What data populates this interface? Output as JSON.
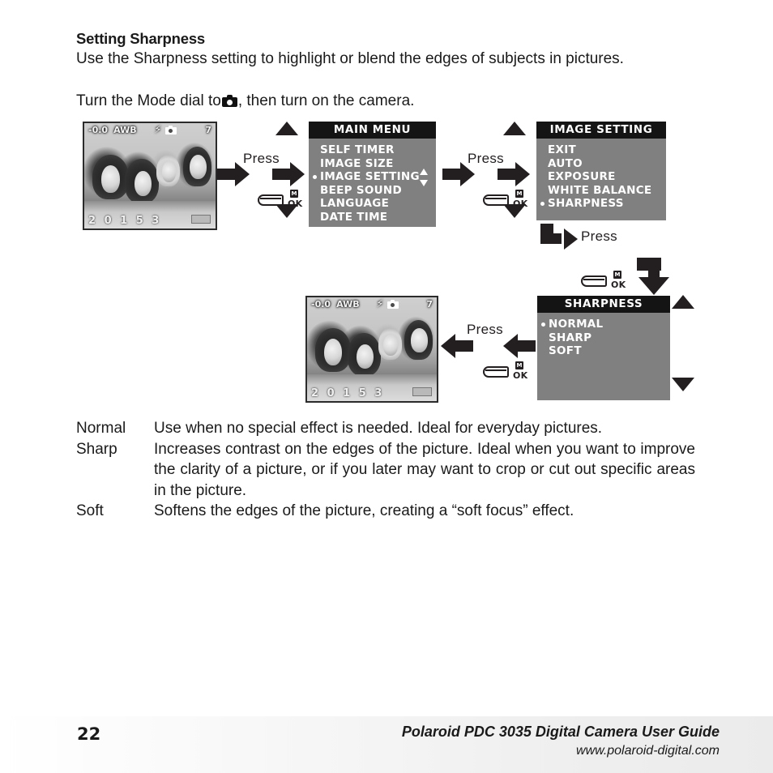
{
  "heading": "Setting Sharpness",
  "intro": {
    "line1": "Use the Sharpness setting to highlight or blend the edges of subjects in pictures.",
    "line2_before": "Turn the Mode dial to",
    "line2_after": ", then turn on the camera."
  },
  "lcd": {
    "ev": "-0.0",
    "awb": "AWB",
    "flash_icon": "flash-bolt-icon",
    "mode_icon": "camera-mode-icon",
    "shots_remaining": "7",
    "bottom_info": "2 0 1 5 3",
    "battery_icon": "battery-icon"
  },
  "menus": {
    "main": {
      "title": "MAIN  MENU",
      "items": [
        {
          "label": "SELF TIMER",
          "selected": false
        },
        {
          "label": "IMAGE  SIZE",
          "selected": false
        },
        {
          "label": "IMAGE  SETTING",
          "selected": true
        },
        {
          "label": "BEEP  SOUND",
          "selected": false
        },
        {
          "label": "LANGUAGE",
          "selected": false
        },
        {
          "label": "DATE  TIME",
          "selected": false
        }
      ]
    },
    "image_setting": {
      "title": "IMAGE SETTING",
      "items": [
        {
          "label": "EXIT",
          "selected": false
        },
        {
          "label": "AUTO",
          "selected": false
        },
        {
          "label": "EXPOSURE",
          "selected": false
        },
        {
          "label": "WHITE BALANCE",
          "selected": false
        },
        {
          "label": "SHARPNESS",
          "selected": true
        }
      ]
    },
    "sharpness": {
      "title": "SHARPNESS",
      "items": [
        {
          "label": "NORMAL",
          "selected": true
        },
        {
          "label": "SHARP",
          "selected": false
        },
        {
          "label": "SOFT",
          "selected": false
        }
      ]
    }
  },
  "flow": {
    "press_1": "Press",
    "press_2": "Press",
    "press_3": "Press",
    "press_4": "Press",
    "button_m": "M",
    "button_ok": "OK"
  },
  "definitions": [
    {
      "term": "Normal",
      "desc": "Use when no special effect is needed. Ideal for everyday pictures."
    },
    {
      "term": "Sharp",
      "desc": "Increases contrast on the edges of the picture. Ideal when you want to improve the clarity of a picture, or if you later may want to crop or cut out specific areas in the picture."
    },
    {
      "term": "Soft",
      "desc": "Softens the edges of the picture, creating a “soft focus” effect."
    }
  ],
  "footer": {
    "page_number": "22",
    "title": "Polaroid PDC 3035 Digital Camera User Guide",
    "url": "www.polaroid-digital.com"
  }
}
